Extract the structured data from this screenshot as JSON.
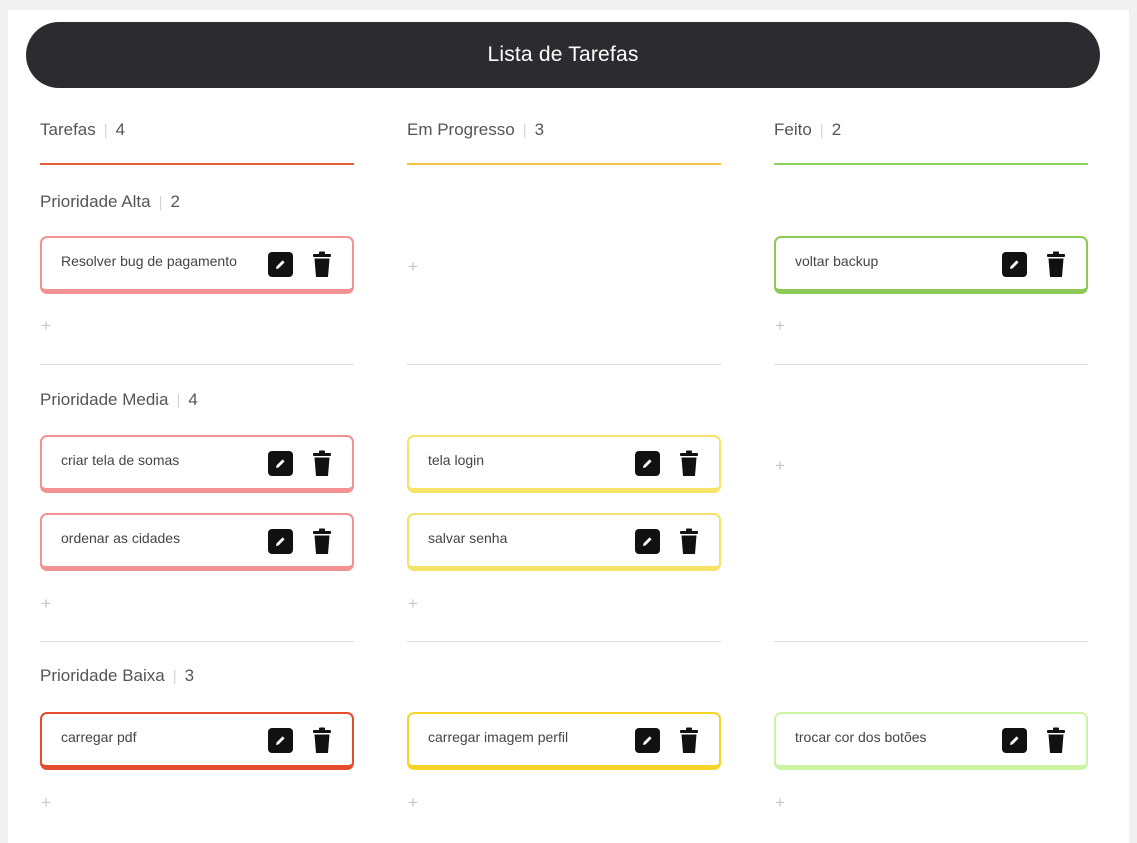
{
  "header": {
    "title": "Lista de Tarefas"
  },
  "columns": [
    {
      "title": "Tarefas",
      "count": "4",
      "color": "#e0603a"
    },
    {
      "title": "Em Progresso",
      "count": "3",
      "color": "#f2c440"
    },
    {
      "title": "Feito",
      "count": "2",
      "color": "#8cd35f"
    }
  ],
  "priorities": [
    {
      "title": "Prioridade Alta",
      "count": "2"
    },
    {
      "title": "Prioridade Media",
      "count": "4"
    },
    {
      "title": "Prioridade Baixa",
      "count": "3"
    }
  ],
  "cards": {
    "alta_tarefas": [
      "Resolver bug de pagamento"
    ],
    "alta_feito": [
      "voltar backup"
    ],
    "media_tarefas": [
      "criar tela de somas",
      "ordenar as cidades"
    ],
    "media_progresso": [
      "tela login",
      "salvar senha"
    ],
    "baixa_tarefas": [
      "carregar pdf"
    ],
    "baixa_progresso": [
      "carregar imagem perfil"
    ],
    "baixa_feito": [
      "trocar cor dos botões"
    ]
  },
  "add_symbol": "+",
  "icons": {
    "edit": "edit-icon",
    "delete": "trash-icon"
  },
  "colors": {
    "header_bg": "#2c2c30",
    "card_red": "#f29292",
    "card_red_strong": "#e34c2c",
    "card_yellow": "#f7e36a",
    "card_green": "#8cca55",
    "card_light_green": "#cdf4a4"
  }
}
